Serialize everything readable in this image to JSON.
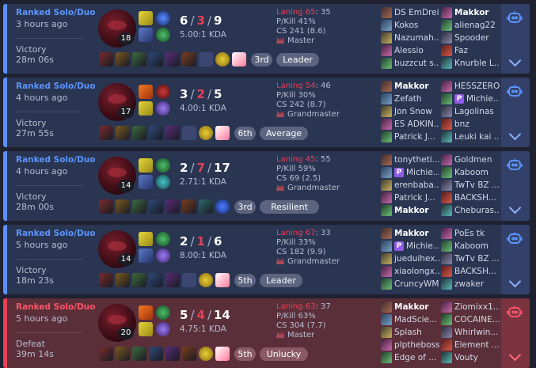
{
  "colors": {
    "win_accent": "#5b8ff9",
    "loss_accent": "#e84057",
    "background": "#1f2130"
  },
  "matches": [
    {
      "result_type": "win",
      "queue": "Ranked Solo/Duo",
      "time_ago": "3 hours ago",
      "result": "Victory",
      "duration": "28m 06s",
      "champion_level": "18",
      "spells": [
        "flash",
        "ghost"
      ],
      "runes": [
        "electrocute",
        "resolve"
      ],
      "kills": "6",
      "deaths": "3",
      "assists": "9",
      "kda_ratio": "5.00:1 KDA",
      "items": [
        "item-1",
        "item-2",
        "item-3",
        "item-4",
        "item-5",
        "item-6",
        "empty",
        "trinket-yellow",
        "exclamation"
      ],
      "placement": "3rd",
      "tag": "Leader",
      "laning_label": "Laning",
      "laning_value": "65",
      "laning_opp": ": 35",
      "pkill": "P/Kill 41%",
      "cs": "CS 241 (8.6)",
      "rank": "Master",
      "team1": [
        {
          "name": "DS EmDrei",
          "me": false,
          "premium": false
        },
        {
          "name": "Kokos",
          "me": false,
          "premium": false
        },
        {
          "name": "Nazumah...",
          "me": false,
          "premium": false
        },
        {
          "name": "Alessio",
          "me": false,
          "premium": false
        },
        {
          "name": "buzzcut s...",
          "me": false,
          "premium": false
        }
      ],
      "team2": [
        {
          "name": "Makkor",
          "me": true,
          "premium": false
        },
        {
          "name": "alienag22",
          "me": false,
          "premium": false
        },
        {
          "name": "Spooder",
          "me": false,
          "premium": false
        },
        {
          "name": "Faz",
          "me": false,
          "premium": false
        },
        {
          "name": "Knurble L...",
          "me": false,
          "premium": false
        }
      ]
    },
    {
      "result_type": "win",
      "queue": "Ranked Solo/Duo",
      "time_ago": "4 hours ago",
      "result": "Victory",
      "duration": "27m 55s",
      "champion_level": "17",
      "spells": [
        "ignite",
        "flash"
      ],
      "runes": [
        "domination",
        "sorcery"
      ],
      "kills": "3",
      "deaths": "2",
      "assists": "5",
      "kda_ratio": "4.00:1 KDA",
      "items": [
        "item-1",
        "item-2",
        "item-3",
        "item-4",
        "item-5",
        "empty",
        "trinket-yellow",
        "exclamation"
      ],
      "placement": "6th",
      "tag": "Average",
      "laning_label": "Laning",
      "laning_value": "54",
      "laning_opp": ": 46",
      "pkill": "P/Kill 30%",
      "cs": "CS 242 (8.7)",
      "rank": "Grandmaster",
      "team1": [
        {
          "name": "Makkor",
          "me": true,
          "premium": false
        },
        {
          "name": "Zefath",
          "me": false,
          "premium": false
        },
        {
          "name": "Jon Snow",
          "me": false,
          "premium": false
        },
        {
          "name": "ES ADKIN...",
          "me": false,
          "premium": false
        },
        {
          "name": "Patrick J...",
          "me": false,
          "premium": false
        }
      ],
      "team2": [
        {
          "name": "HESSZERO",
          "me": false,
          "premium": false
        },
        {
          "name": "Michie...",
          "me": false,
          "premium": true
        },
        {
          "name": "Lagolinas",
          "me": false,
          "premium": false
        },
        {
          "name": "bnz",
          "me": false,
          "premium": false
        },
        {
          "name": "Leuki kai ...",
          "me": false,
          "premium": false
        }
      ]
    },
    {
      "result_type": "win",
      "queue": "Ranked Solo/Duo",
      "time_ago": "4 hours ago",
      "result": "Victory",
      "duration": "28m 00s",
      "champion_level": "14",
      "spells": [
        "flash",
        "ghost"
      ],
      "runes": [
        "resolve",
        "inspiration"
      ],
      "kills": "2",
      "deaths": "7",
      "assists": "17",
      "kda_ratio": "2.71:1 KDA",
      "items": [
        "item-1",
        "item-2",
        "item-3",
        "item-4",
        "item-5",
        "item-6",
        "item-7",
        "ward-blue"
      ],
      "placement": "3rd",
      "tag": "Resilient",
      "laning_label": "Laning",
      "laning_value": "45",
      "laning_opp": ": 55",
      "pkill": "P/Kill 59%",
      "cs": "CS 69 (2.5)",
      "rank": "Grandmaster",
      "team1": [
        {
          "name": "tonytheti...",
          "me": false,
          "premium": false
        },
        {
          "name": "Michie...",
          "me": false,
          "premium": true
        },
        {
          "name": "erenbaba...",
          "me": false,
          "premium": false
        },
        {
          "name": "Patrick J...",
          "me": false,
          "premium": false
        },
        {
          "name": "Makkor",
          "me": true,
          "premium": false
        }
      ],
      "team2": [
        {
          "name": "Goldmen",
          "me": false,
          "premium": false
        },
        {
          "name": "Kaboom",
          "me": false,
          "premium": false
        },
        {
          "name": "TwTv BZ ...",
          "me": false,
          "premium": false
        },
        {
          "name": "BACKSH...",
          "me": false,
          "premium": false
        },
        {
          "name": "Cheburas...",
          "me": false,
          "premium": false
        }
      ]
    },
    {
      "result_type": "win",
      "queue": "Ranked Solo/Duo",
      "time_ago": "5 hours ago",
      "result": "Victory",
      "duration": "18m 23s",
      "champion_level": "14",
      "spells": [
        "flash",
        "ghost"
      ],
      "runes": [
        "resolve",
        "sorcery"
      ],
      "kills": "2",
      "deaths": "1",
      "assists": "6",
      "kda_ratio": "8.00:1 KDA",
      "items": [
        "item-1",
        "item-2",
        "item-3",
        "item-4",
        "item-5",
        "empty",
        "trinket-yellow",
        "exclamation"
      ],
      "placement": "5th",
      "tag": "Leader",
      "laning_label": "Laning",
      "laning_value": "67",
      "laning_opp": ": 33",
      "pkill": "P/Kill 33%",
      "cs": "CS 182 (9.9)",
      "rank": "Grandmaster",
      "team1": [
        {
          "name": "Makkor",
          "me": true,
          "premium": false
        },
        {
          "name": "Michie...",
          "me": false,
          "premium": true
        },
        {
          "name": "jueduihex...",
          "me": false,
          "premium": false
        },
        {
          "name": "xiaolongx...",
          "me": false,
          "premium": false
        },
        {
          "name": "CruncyWM",
          "me": false,
          "premium": false
        }
      ],
      "team2": [
        {
          "name": "PoEs tk",
          "me": false,
          "premium": false
        },
        {
          "name": "Kaboom",
          "me": false,
          "premium": false
        },
        {
          "name": "TwTv BZ ...",
          "me": false,
          "premium": false
        },
        {
          "name": "BACKSH...",
          "me": false,
          "premium": false
        },
        {
          "name": "zwaker",
          "me": false,
          "premium": false
        }
      ]
    },
    {
      "result_type": "loss",
      "queue": "Ranked Solo/Duo",
      "time_ago": "5 hours ago",
      "result": "Defeat",
      "duration": "39m 14s",
      "champion_level": "20",
      "spells": [
        "ignite",
        "flash"
      ],
      "runes": [
        "resolve",
        "sorcery"
      ],
      "kills": "5",
      "deaths": "4",
      "assists": "14",
      "kda_ratio": "4.75:1 KDA",
      "items": [
        "item-1",
        "item-2",
        "item-3",
        "item-4",
        "item-5",
        "item-6",
        "trinket-yellow",
        "exclamation"
      ],
      "placement": "5th",
      "tag": "Unlucky",
      "laning_label": "Laning",
      "laning_value": "63",
      "laning_opp": ": 37",
      "pkill": "P/Kill 63%",
      "cs": "CS 304 (7.7)",
      "rank": "Master",
      "team1": [
        {
          "name": "Makkor",
          "me": true,
          "premium": false
        },
        {
          "name": "MadScie...",
          "me": false,
          "premium": false
        },
        {
          "name": "Splash",
          "me": false,
          "premium": false
        },
        {
          "name": "plptheboss",
          "me": false,
          "premium": false
        },
        {
          "name": "Edge of ...",
          "me": false,
          "premium": false
        }
      ],
      "team2": [
        {
          "name": "Ziomixx1...",
          "me": false,
          "premium": false
        },
        {
          "name": "COCAINE...",
          "me": false,
          "premium": false
        },
        {
          "name": "Whirlwin...",
          "me": false,
          "premium": false
        },
        {
          "name": "Element ...",
          "me": false,
          "premium": false
        },
        {
          "name": "Vouty",
          "me": false,
          "premium": false
        }
      ]
    }
  ]
}
